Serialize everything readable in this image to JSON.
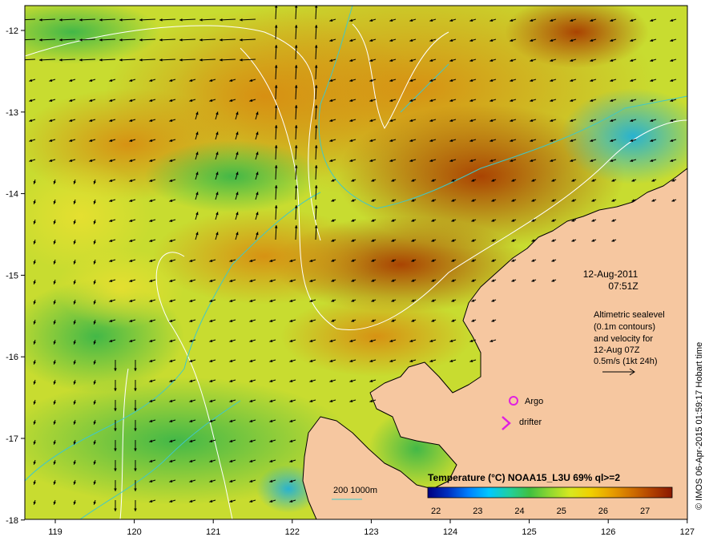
{
  "map": {
    "date_line": "12-Aug-2011",
    "time_line": "07:51Z",
    "legend_lines": [
      "Altimetric sealevel",
      "(0.1m contours)",
      "and velocity for",
      "12-Aug 07Z",
      "0.5m/s (1kt 24h)"
    ],
    "argo_label": "Argo",
    "drifter_label": "drifter",
    "bathy_label": "200  1000m",
    "credit": "© IMOS 06-Apr-2015 01:59:17 Hobart time",
    "lon_ticks": [
      "119",
      "120",
      "121",
      "122",
      "123",
      "124",
      "125",
      "126",
      "127"
    ],
    "lat_ticks": [
      "-12",
      "-13",
      "-14",
      "-15",
      "-16",
      "-17",
      "-18"
    ],
    "colorbar": {
      "title": "Temperature (°C) NOAA15_L3U 69% ql>=2",
      "tick_labels": [
        "22",
        "23",
        "24",
        "25",
        "26",
        "27"
      ],
      "colors": [
        "#000080",
        "#0030c0",
        "#0080ff",
        "#00c8ff",
        "#20d0a0",
        "#40c040",
        "#90d830",
        "#d8e820",
        "#f0d000",
        "#e8a000",
        "#d07000",
        "#b04000",
        "#8a1800"
      ]
    },
    "colors": {
      "land": "#f6c7a0",
      "contour": "#ffffff",
      "bathy": "#40c8c8",
      "argo": "#e020e0",
      "drifter": "#e020e0",
      "arrow": "#000000"
    }
  }
}
